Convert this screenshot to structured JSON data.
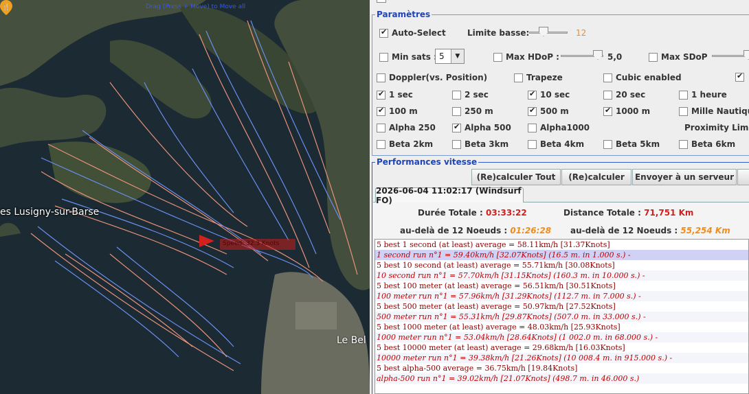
{
  "map": {
    "hint": "Drag (Press + Move) to Move all",
    "place_label": "es Lusigny-sur-Barse",
    "speed_tag": "Speed: 32.3 Knots",
    "poi_label": "Le Bel",
    "colors": {
      "water": "#1b2a33",
      "land": "#3d4a3a",
      "track_blue": "#6a8ff0",
      "track_orange": "#e9927a"
    }
  },
  "panel": {
    "params_title": "Paramètres",
    "auto_select": {
      "label": "Auto-Select",
      "checked": true
    },
    "limite_basse": {
      "label": "Limite basse:",
      "value": "12"
    },
    "min_sats": {
      "label": "Min sats :",
      "checked": false,
      "value": "5"
    },
    "max_hdop": {
      "label": "Max HDoP :",
      "checked": false,
      "value": "5,0"
    },
    "max_sdop": {
      "label": "Max SDoP",
      "checked": false
    },
    "options_row": [
      {
        "label": "Doppler(vs. Position)",
        "checked": false
      },
      {
        "label": "Trapeze",
        "checked": false
      },
      {
        "label": "Cubic enabled",
        "checked": false
      }
    ],
    "time_row": [
      {
        "label": "1 sec",
        "checked": true
      },
      {
        "label": "2 sec",
        "checked": false
      },
      {
        "label": "10 sec",
        "checked": true
      },
      {
        "label": "20 sec",
        "checked": false
      },
      {
        "label": "1 heure",
        "checked": false
      }
    ],
    "dist_row": [
      {
        "label": "100 m",
        "checked": true
      },
      {
        "label": "250 m",
        "checked": false
      },
      {
        "label": "500 m",
        "checked": true
      },
      {
        "label": "1000 m",
        "checked": true
      },
      {
        "label": "Mille Nautique",
        "checked": false
      }
    ],
    "alpha_row": [
      {
        "label": "Alpha 250",
        "checked": false
      },
      {
        "label": "Alpha 500",
        "checked": true
      },
      {
        "label": "Alpha1000",
        "checked": false
      }
    ],
    "proximity_label": "Proximity Limits",
    "beta_row": [
      {
        "label": "Beta 2km",
        "checked": false
      },
      {
        "label": "Beta 3km",
        "checked": false
      },
      {
        "label": "Beta 4km",
        "checked": false
      },
      {
        "label": "Beta 5km",
        "checked": false
      },
      {
        "label": "Beta 6km",
        "checked": false
      }
    ],
    "perf_title": "Performances vitesse",
    "buttons": {
      "recalc_all": "(Re)calculer Tout",
      "recalc": "(Re)calculer",
      "send": "Envoyer à un serveur"
    },
    "session_tab": "2026-06-04 11:02:17 (Windsurf FO)",
    "stats": {
      "duree_label": "Durée Totale :",
      "duree_value": "03:33:22",
      "distance_label": "Distance Totale :",
      "distance_value": "71,751 Km",
      "beyond_prefix": "au-delà de",
      "beyond_knots": "12",
      "noeuds_label": "Noeuds :",
      "beyond_time": "01:26:28",
      "beyond_dist": "55,254 Km"
    },
    "results": [
      "5 best 1 second (at least) average = 58.11km/h [31.37Knots]",
      "1 second run n°1 = 59.40km/h [32.07Knots] (16.5 m. in 1.000 s.) -",
      "5 best 10 second (at least) average = 55.71km/h [30.08Knots]",
      "10 second run n°1 = 57.70km/h [31.15Knots] (160.3 m. in 10.000 s.) -",
      "5 best 100 meter (at least) average = 56.51km/h [30.51Knots]",
      "100 meter run n°1 = 57.96km/h [31.29Knots] (112.7 m. in 7.000 s.) -",
      "5 best 500 meter (at least) average = 50.97km/h [27.52Knots]",
      "500 meter run n°1 = 55.31km/h [29.87Knots] (507.0 m. in 33.000 s.) -",
      "5 best 1000 meter (at least) average = 48.03km/h [25.93Knots]",
      "1000 meter run n°1 = 53.04km/h [28.64Knots] (1 002.0 m. in 68.000 s.) -",
      "5 best 10000 meter (at least) average = 29.68km/h [16.03Knots]",
      "10000 meter run n°1 = 39.38km/h [21.26Knots] (10 008.4 m. in 915.000 s.) -",
      "5 best alpha-500 average = 36.75km/h [19.84Knots]",
      "alpha-500 run n°1 = 39.02km/h [21.07Knots] (498.7 m. in 46.000 s.)"
    ]
  }
}
